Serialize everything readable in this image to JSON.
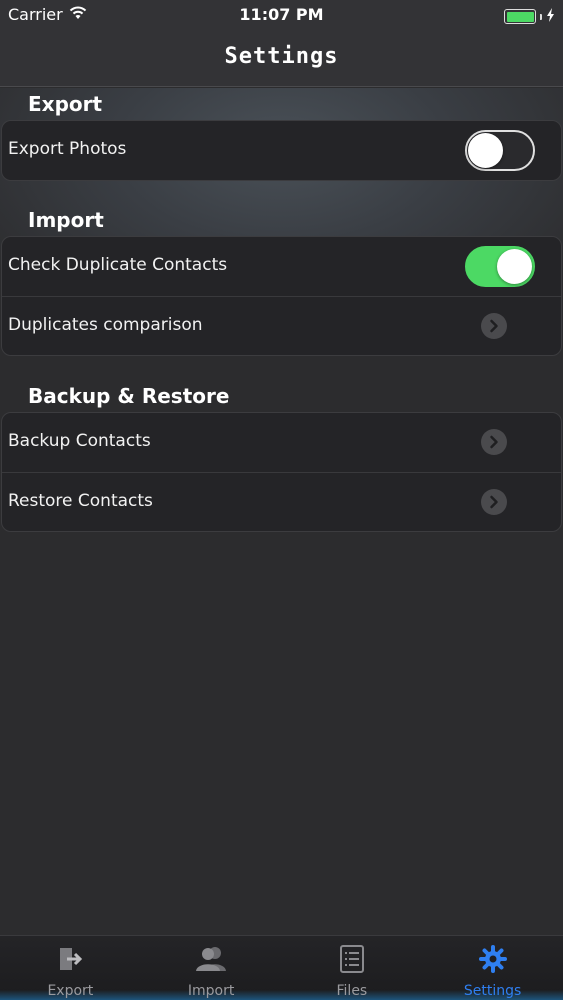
{
  "status_bar": {
    "carrier": "Carrier",
    "time": "11:07 PM"
  },
  "nav": {
    "title": "Settings"
  },
  "sections": [
    {
      "header": "Export",
      "rows": [
        {
          "label": "Export Photos",
          "control": "toggle",
          "on": false
        }
      ]
    },
    {
      "header": "Import",
      "rows": [
        {
          "label": "Check Duplicate Contacts",
          "control": "toggle",
          "on": true
        },
        {
          "label": "Duplicates comparison",
          "control": "disclosure"
        }
      ]
    },
    {
      "header": "Backup & Restore",
      "rows": [
        {
          "label": "Backup Contacts",
          "control": "disclosure"
        },
        {
          "label": "Restore Contacts",
          "control": "disclosure"
        }
      ]
    }
  ],
  "tab_bar": {
    "tabs": [
      {
        "label": "Export",
        "icon": "export-icon",
        "active": false
      },
      {
        "label": "Import",
        "icon": "people-icon",
        "active": false
      },
      {
        "label": "Files",
        "icon": "list-icon",
        "active": false
      },
      {
        "label": "Settings",
        "icon": "gear-icon",
        "active": true
      }
    ]
  },
  "colors": {
    "accent": "#2f7ff0",
    "toggle_on": "#4cd964",
    "background": "#2c2c2e"
  }
}
